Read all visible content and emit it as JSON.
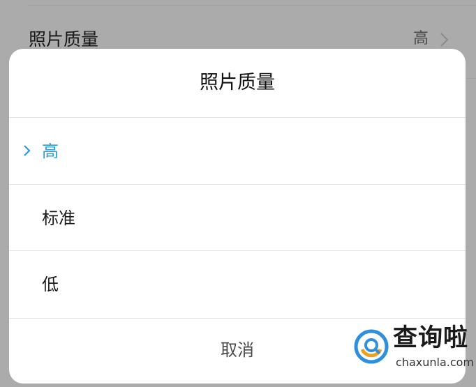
{
  "background_screen": {
    "setting_label": "照片质量",
    "setting_value": "高"
  },
  "dialog": {
    "title": "照片质量",
    "options": [
      {
        "label": "高",
        "selected": true
      },
      {
        "label": "标准",
        "selected": false
      },
      {
        "label": "低",
        "selected": false
      }
    ],
    "cancel_label": "取消"
  },
  "watermark": {
    "text": "查询啦",
    "url": "chaxunla.com"
  },
  "colors": {
    "accent": "#2a9dd4",
    "overlay": "#ababab"
  },
  "icons": {
    "selected_marker": "chevron-right-icon",
    "row_arrow": "chevron-right-icon"
  }
}
